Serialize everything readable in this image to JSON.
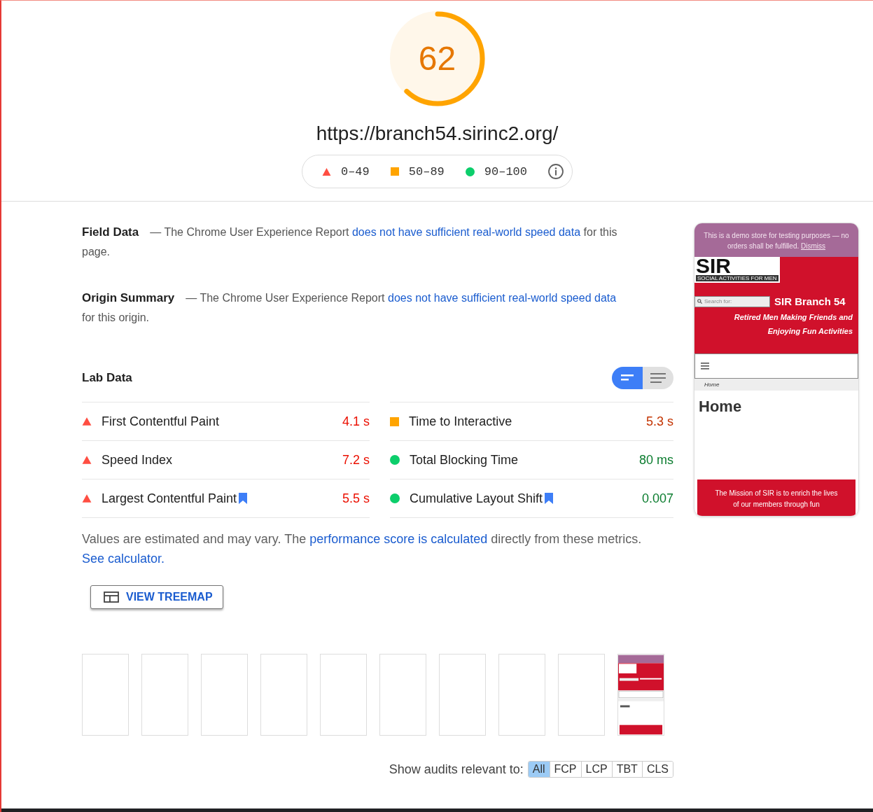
{
  "score": {
    "value": "62"
  },
  "url": "https://branch54.sirinc2.org/",
  "legend": [
    {
      "kind": "fail",
      "label": "0–49"
    },
    {
      "kind": "average",
      "label": "50–89"
    },
    {
      "kind": "pass",
      "label": "90–100"
    }
  ],
  "field_data": {
    "title": "Field Data",
    "before": "— The Chrome User Experience Report ",
    "link": "does not have sufficient real-world speed data",
    "after": " for this page."
  },
  "origin_summary": {
    "title": "Origin Summary",
    "before": "— The Chrome User Experience Report ",
    "link": "does not have sufficient real-world speed data",
    "after": " for this origin."
  },
  "lab_data": {
    "title": "Lab Data",
    "toggle": [
      {
        "kind": "compact",
        "selected": true
      },
      {
        "kind": "expanded",
        "selected": false
      }
    ],
    "metrics": [
      {
        "name": "First Contentful Paint",
        "value": "4.1 s",
        "kind": "fail",
        "bookmark": false
      },
      {
        "name": "Time to Interactive",
        "value": "5.3 s",
        "kind": "average",
        "bookmark": false
      },
      {
        "name": "Speed Index",
        "value": "7.2 s",
        "kind": "fail",
        "bookmark": false
      },
      {
        "name": "Total Blocking Time",
        "value": "80 ms",
        "kind": "pass",
        "bookmark": false
      },
      {
        "name": "Largest Contentful Paint",
        "value": "5.5 s",
        "kind": "fail",
        "bookmark": true
      },
      {
        "name": "Cumulative Layout Shift",
        "value": "0.007",
        "kind": "pass",
        "bookmark": true
      }
    ]
  },
  "note": [
    {
      "kind": "text",
      "text": "Values are estimated and may vary. The "
    },
    {
      "kind": "link",
      "text": "performance score is calculated"
    },
    {
      "kind": "text",
      "text": " directly from these metrics. "
    },
    {
      "kind": "link",
      "text": "See calculator."
    }
  ],
  "treemap_button": "VIEW TREEMAP",
  "filmstrip": [
    {
      "kind": "blank"
    },
    {
      "kind": "blank"
    },
    {
      "kind": "blank"
    },
    {
      "kind": "blank"
    },
    {
      "kind": "blank"
    },
    {
      "kind": "blank"
    },
    {
      "kind": "blank"
    },
    {
      "kind": "blank"
    },
    {
      "kind": "blank"
    },
    {
      "kind": "screenshot"
    }
  ],
  "page_screenshot": {
    "banner": "This is a demo store for testing purposes — no orders shall be fulfilled.",
    "dismiss": "Dismiss",
    "logo": "SIR",
    "logo_tagline": "SOCIAL ACTIVITIES FOR MEN",
    "search_placeholder": "Search for:",
    "site_title": "SIR Branch 54",
    "tagline": "Retired Men Making Friends and Enjoying Fun Activities",
    "breadcrumb": "Home",
    "heading": "Home",
    "mission": "The Mission of SIR is to enrich the lives of our members through fun"
  },
  "audit_filter": {
    "label": "Show audits relevant to:",
    "chips": [
      {
        "label": "All",
        "selected": true
      },
      {
        "label": "FCP",
        "selected": false
      },
      {
        "label": "LCP",
        "selected": false
      },
      {
        "label": "TBT",
        "selected": false
      },
      {
        "label": "CLS",
        "selected": false
      }
    ]
  }
}
